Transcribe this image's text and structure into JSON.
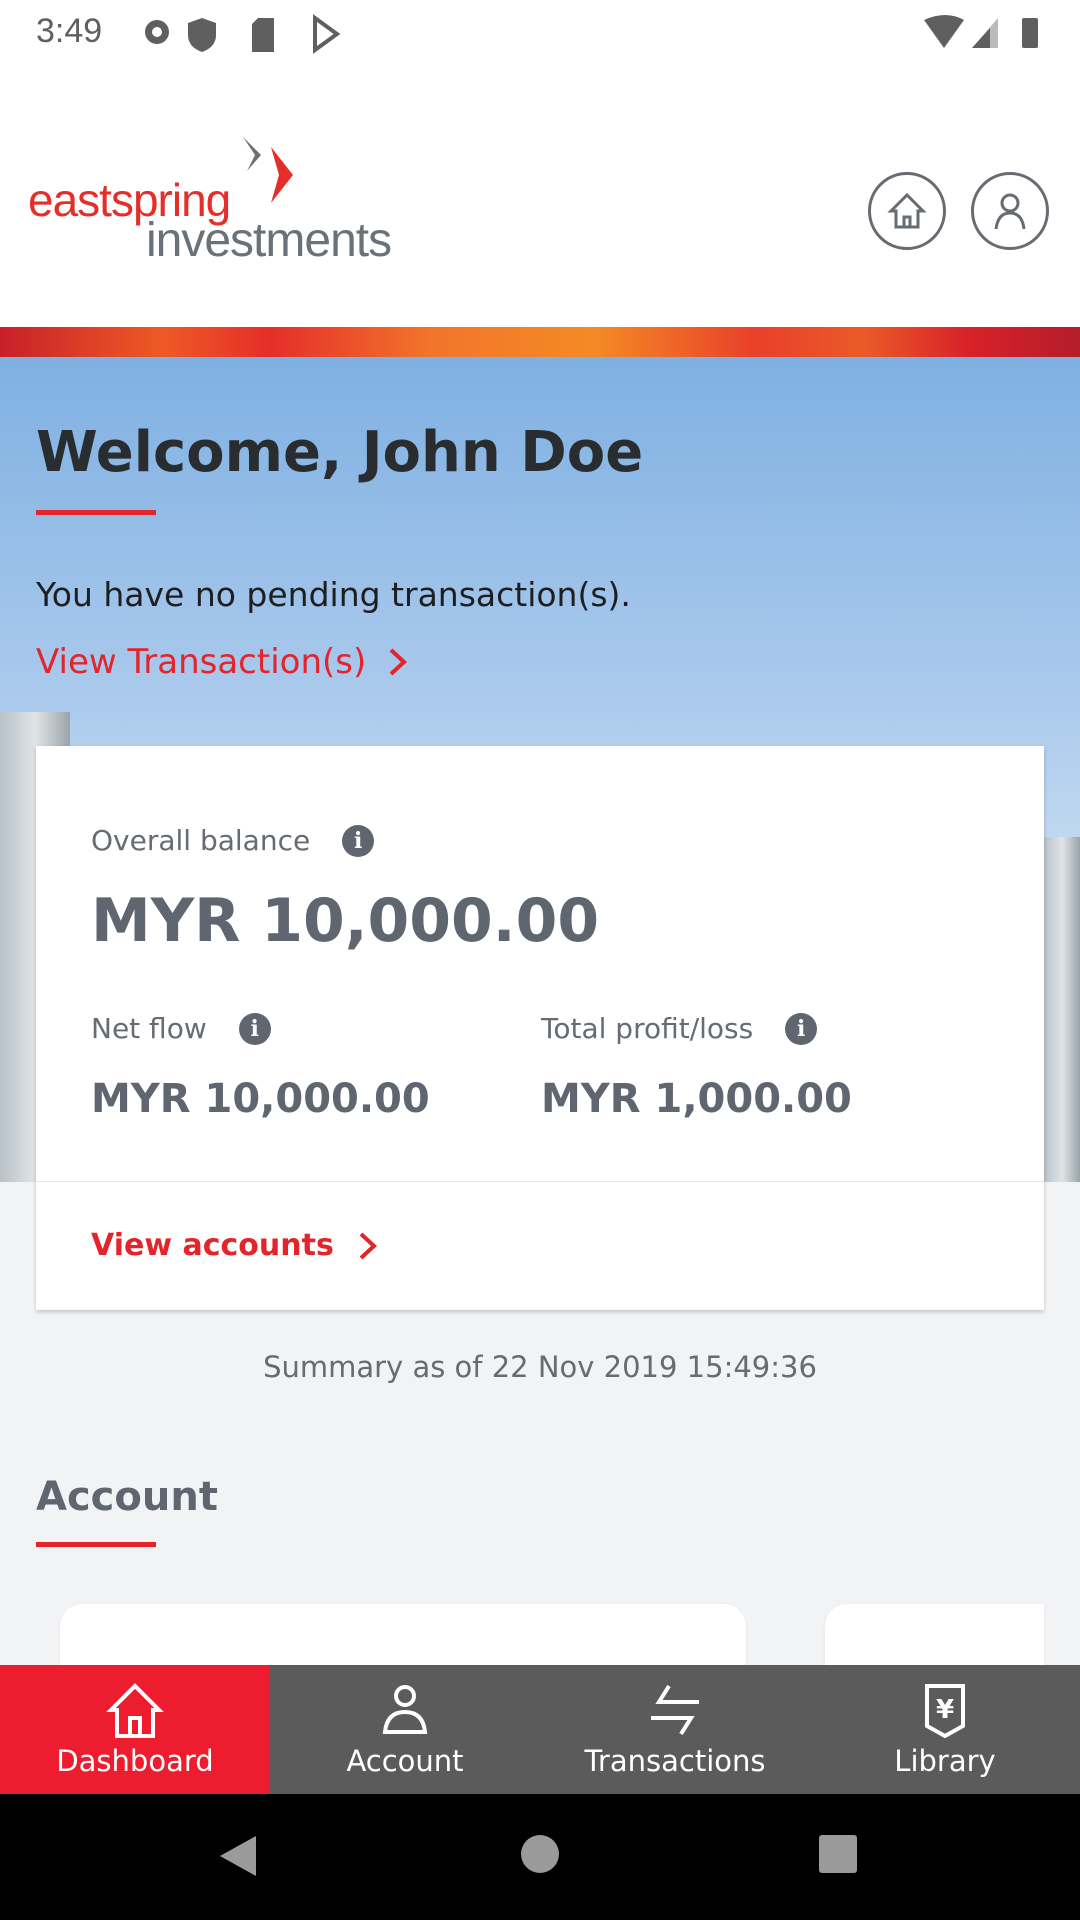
{
  "status_bar": {
    "time": "3:49",
    "icons": [
      "gear-icon",
      "shield-icon",
      "sd-card-icon",
      "play-store-icon",
      "wifi-icon",
      "signal-icon",
      "battery-icon"
    ]
  },
  "header": {
    "logo_top": "eastspring",
    "logo_bottom": "investments",
    "home_icon": "home-icon",
    "profile_icon": "user-icon"
  },
  "hero": {
    "title": "Welcome, John Doe",
    "pending_text": "You have no pending transaction(s).",
    "view_transactions": "View Transaction(s)"
  },
  "summary_card": {
    "overall_label": "Overall balance",
    "overall_value": "MYR 10,000.00",
    "netflow_label": "Net flow",
    "netflow_value": "MYR 10,000.00",
    "profit_label": "Total profit/loss",
    "profit_value": "MYR 1,000.00",
    "view_accounts": "View accounts"
  },
  "summary_text": "Summary as of 22 Nov 2019 15:49:36",
  "account_section": {
    "title": "Account"
  },
  "bottom_nav": {
    "items": [
      {
        "label": "Dashboard",
        "icon": "home-icon",
        "active": true
      },
      {
        "label": "Account",
        "icon": "user-icon"
      },
      {
        "label": "Transactions",
        "icon": "swap-icon"
      },
      {
        "label": "Library",
        "icon": "library-yen-icon"
      }
    ]
  },
  "colors": {
    "brand_red": "#e3242b",
    "nav_active": "#ed1c2e",
    "nav_bg": "#5b5b5b",
    "text_gray": "#5f6670"
  }
}
